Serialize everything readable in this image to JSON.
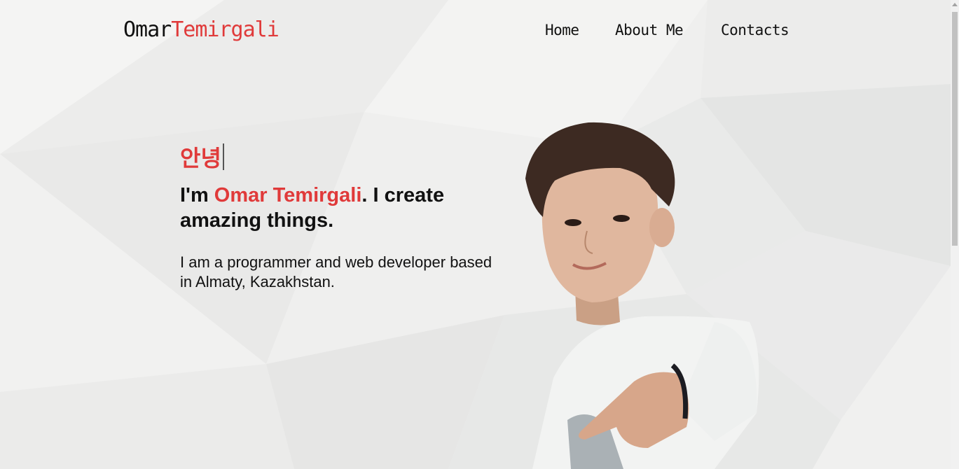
{
  "header": {
    "logo_first": "Omar",
    "logo_last": "Temirgali",
    "nav": [
      {
        "label": "Home"
      },
      {
        "label": "About Me"
      },
      {
        "label": "Contacts"
      }
    ]
  },
  "hero": {
    "greeting": "안녕",
    "headline_prefix": "I'm ",
    "headline_name": "Omar Temirgali",
    "headline_suffix": ". I create amazing things.",
    "intro": "I am a programmer and web developer based in Almaty, Kazakhstan."
  },
  "colors": {
    "accent": "#e03a3a",
    "background": "#efefee",
    "text": "#111111"
  },
  "icons": {
    "scroll_up": "scroll-up-arrow-icon"
  }
}
